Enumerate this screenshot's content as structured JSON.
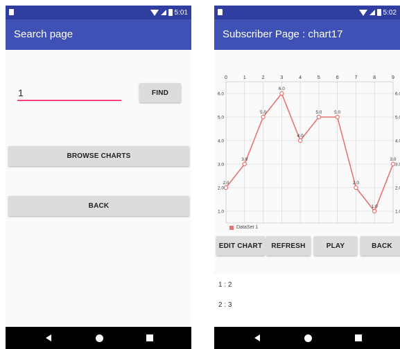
{
  "left_screen": {
    "status": {
      "time": "5:01"
    },
    "app_bar": {
      "title": "Search page"
    },
    "search": {
      "value": "1"
    },
    "find_label": "FIND",
    "browse_label": "BROWSE CHARTS",
    "back_label": "BACK"
  },
  "right_screen": {
    "status": {
      "time": "5:02"
    },
    "app_bar": {
      "title": "Subscriber Page : chart17"
    },
    "buttons": {
      "edit": "EDIT CHART",
      "refresh": "REFRESH",
      "play": "PLAY",
      "back": "BACK"
    },
    "messages": [
      "1 : 2",
      "2 : 3"
    ]
  },
  "chart_data": {
    "type": "line",
    "x": [
      0,
      1,
      2,
      3,
      4,
      5,
      6,
      7,
      8,
      9
    ],
    "series": [
      {
        "name": "DataSet 1",
        "values": [
          2.0,
          3.0,
          5.0,
          6.0,
          4.0,
          5.0,
          5.0,
          2.0,
          1.0,
          3.0
        ],
        "color": "#e57373"
      }
    ],
    "x_ticks": [
      "0",
      "1",
      "2",
      "3",
      "4",
      "5",
      "6",
      "7",
      "8",
      "9"
    ],
    "y_ticks": [
      "1.0",
      "2.0",
      "3.0",
      "4.0",
      "5.0",
      "6.0"
    ],
    "value_labels": [
      "2.0",
      "3.0",
      "5.0",
      "6.0",
      "4.0",
      "5.0",
      "5.0",
      "2.0",
      "1.0",
      "3.0"
    ],
    "xlim": [
      0,
      9
    ],
    "ylim": [
      0.5,
      6.5
    ],
    "grid": true,
    "legend_position": "bottom-left"
  }
}
